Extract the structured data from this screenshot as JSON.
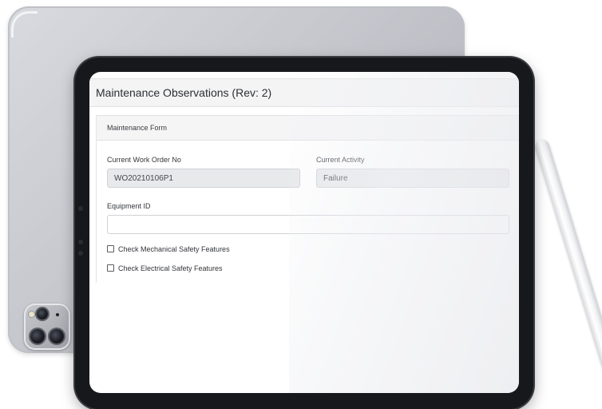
{
  "app": {
    "title": "Maintenance Observations (Rev: 2)"
  },
  "form": {
    "header": "Maintenance Form",
    "work_order": {
      "label": "Current Work Order No",
      "value": "WO20210106P1"
    },
    "activity": {
      "label": "Current Activity",
      "value": "Failure"
    },
    "equipment": {
      "label": "Equipment ID",
      "value": ""
    },
    "checks": [
      {
        "label": "Check Mechanical Safety Features",
        "checked": false
      },
      {
        "label": "Check Electrical Safety Features",
        "checked": false
      }
    ]
  },
  "colors": {
    "header_bg": "#f4f4f5",
    "readonly_input_bg": "#e8e9eb",
    "device_bezel": "#17181b",
    "device_back": "#c9cbd1"
  }
}
